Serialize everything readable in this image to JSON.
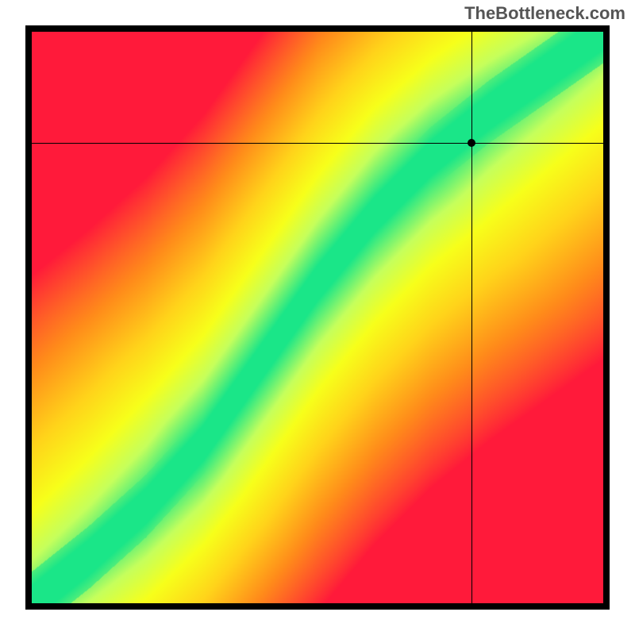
{
  "attribution": "TheBottleneck.com",
  "chart_data": {
    "type": "heatmap",
    "title": "",
    "xlabel": "",
    "ylabel": "",
    "xlim": [
      0,
      1
    ],
    "ylim": [
      0,
      1
    ],
    "crosshair": {
      "x": 0.77,
      "y": 0.805
    },
    "marker": {
      "x": 0.77,
      "y": 0.805
    },
    "colormap": [
      {
        "t": 0.0,
        "color": "#ff1a3a"
      },
      {
        "t": 0.33,
        "color": "#ff8c1a"
      },
      {
        "t": 0.55,
        "color": "#ffd41a"
      },
      {
        "t": 0.72,
        "color": "#f7ff1a"
      },
      {
        "t": 0.85,
        "color": "#c5ff5c"
      },
      {
        "t": 1.0,
        "color": "#00e28f"
      }
    ],
    "ideal_curve": {
      "description": "Optimal GPU-to-CPU balance curve (narrow green band). S-shaped curve from origin curving upward steeply.",
      "points": [
        {
          "x": 0.0,
          "y": 0.0
        },
        {
          "x": 0.1,
          "y": 0.08
        },
        {
          "x": 0.2,
          "y": 0.17
        },
        {
          "x": 0.3,
          "y": 0.28
        },
        {
          "x": 0.4,
          "y": 0.42
        },
        {
          "x": 0.5,
          "y": 0.56
        },
        {
          "x": 0.6,
          "y": 0.68
        },
        {
          "x": 0.7,
          "y": 0.78
        },
        {
          "x": 0.8,
          "y": 0.86
        },
        {
          "x": 0.9,
          "y": 0.93
        },
        {
          "x": 1.0,
          "y": 1.0
        }
      ],
      "band_halfwidth": 0.055
    },
    "marker_region": "near edge of optimal band (green/yellow boundary)"
  }
}
